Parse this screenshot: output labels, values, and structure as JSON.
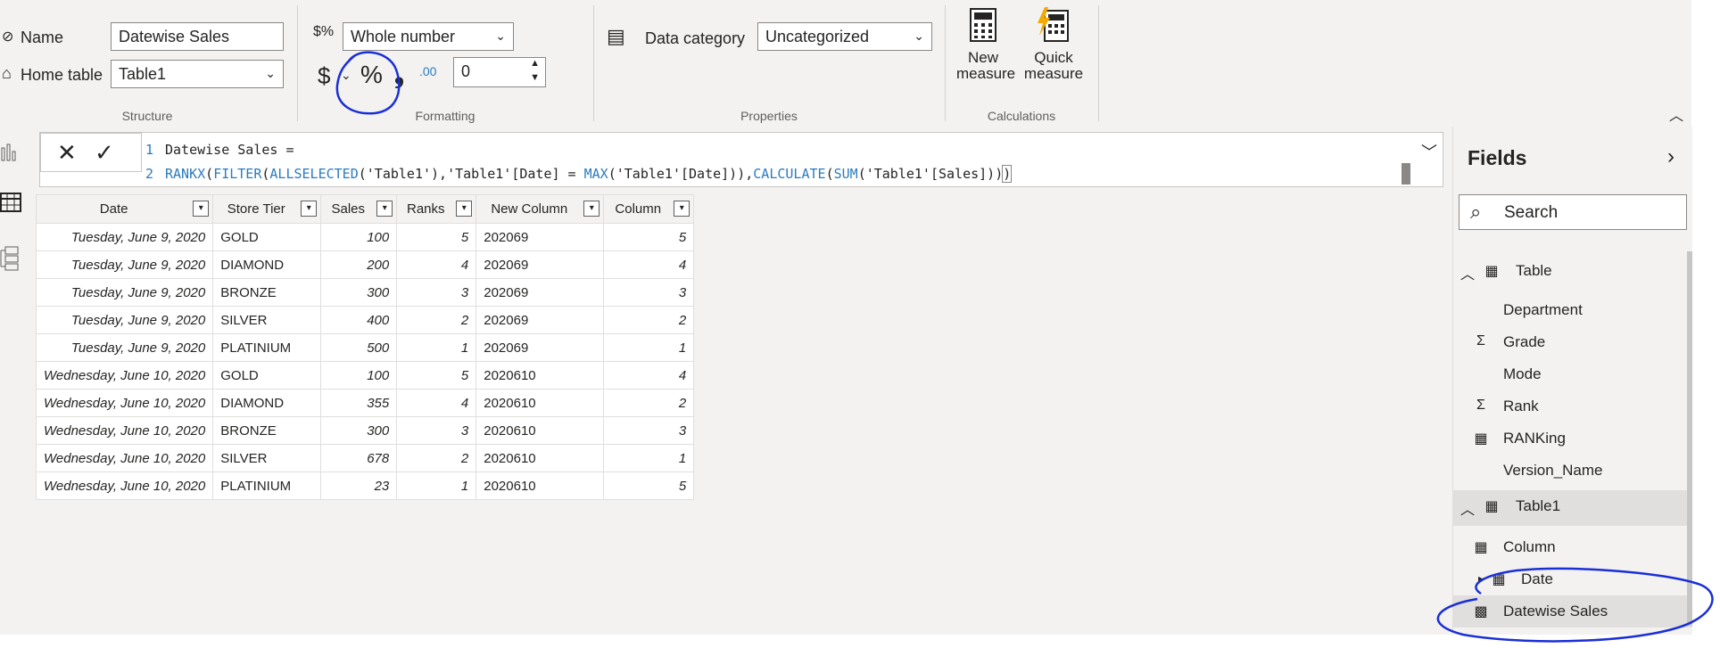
{
  "ribbon": {
    "structure": {
      "name_label": "Name",
      "name_value": "Datewise Sales",
      "home_table_label": "Home table",
      "home_table_value": "Table1",
      "group_label": "Structure"
    },
    "formatting": {
      "format_value": "Whole number",
      "currency_symbol": "$",
      "percent_symbol": "%",
      "comma_symbol": "❟",
      "decimal_symbol": ".00",
      "decimals_value": "0",
      "group_label": "Formatting"
    },
    "properties": {
      "data_category_label": "Data category",
      "data_category_value": "Uncategorized",
      "group_label": "Properties"
    },
    "calculations": {
      "new_measure_line1": "New",
      "new_measure_line2": "measure",
      "quick_measure_line1": "Quick",
      "quick_measure_line2": "measure",
      "group_label": "Calculations"
    }
  },
  "formula_bar": {
    "line1_no": "1",
    "line1": "Datewise Sales =",
    "line2_no": "2",
    "line2_parts": {
      "p1": "RANKX",
      "p2": "(",
      "p3": "FILTER",
      "p4": "(",
      "p5": "ALLSELECTED",
      "p6": "('Table1'),'Table1'[Date] = ",
      "p7": "MAX",
      "p8": "('Table1'[Date])),",
      "p9": "CALCULATE",
      "p10": "(",
      "p11": "SUM",
      "p12": "('Table1'[Sales]))",
      "p13": ")"
    }
  },
  "table": {
    "headers": [
      "Date",
      "Store Tier",
      "Sales",
      "Ranks",
      "New Column",
      "Column"
    ],
    "rows": [
      [
        "Tuesday, June 9, 2020",
        "GOLD",
        "100",
        "5",
        "202069",
        "5"
      ],
      [
        "Tuesday, June 9, 2020",
        "DIAMOND",
        "200",
        "4",
        "202069",
        "4"
      ],
      [
        "Tuesday, June 9, 2020",
        "BRONZE",
        "300",
        "3",
        "202069",
        "3"
      ],
      [
        "Tuesday, June 9, 2020",
        "SILVER",
        "400",
        "2",
        "202069",
        "2"
      ],
      [
        "Tuesday, June 9, 2020",
        "PLATINIUM",
        "500",
        "1",
        "202069",
        "1"
      ],
      [
        "Wednesday, June 10, 2020",
        "GOLD",
        "100",
        "5",
        "2020610",
        "4"
      ],
      [
        "Wednesday, June 10, 2020",
        "DIAMOND",
        "355",
        "4",
        "2020610",
        "2"
      ],
      [
        "Wednesday, June 10, 2020",
        "BRONZE",
        "300",
        "3",
        "2020610",
        "3"
      ],
      [
        "Wednesday, June 10, 2020",
        "SILVER",
        "678",
        "2",
        "2020610",
        "1"
      ],
      [
        "Wednesday, June 10, 2020",
        "PLATINIUM",
        "23",
        "1",
        "2020610",
        "5"
      ]
    ]
  },
  "fields_pane": {
    "title": "Fields",
    "search_placeholder": "Search",
    "items": [
      {
        "label": "Table",
        "kind": "table"
      },
      {
        "label": "Department",
        "kind": "field"
      },
      {
        "label": "Grade",
        "kind": "sum"
      },
      {
        "label": "Mode",
        "kind": "field"
      },
      {
        "label": "Rank",
        "kind": "sum"
      },
      {
        "label": "RANKing",
        "kind": "calc-column"
      },
      {
        "label": "Version_Name",
        "kind": "field"
      },
      {
        "label": "Table1",
        "kind": "table"
      },
      {
        "label": "Column",
        "kind": "calc-column"
      },
      {
        "label": "Date",
        "kind": "date"
      },
      {
        "label": "Datewise Sales",
        "kind": "measure"
      }
    ]
  },
  "colors": {
    "ribbon_bg": "#f3f2f1",
    "annotation": "#1a2fd6",
    "dax_keyword": "#2b7bbd"
  }
}
